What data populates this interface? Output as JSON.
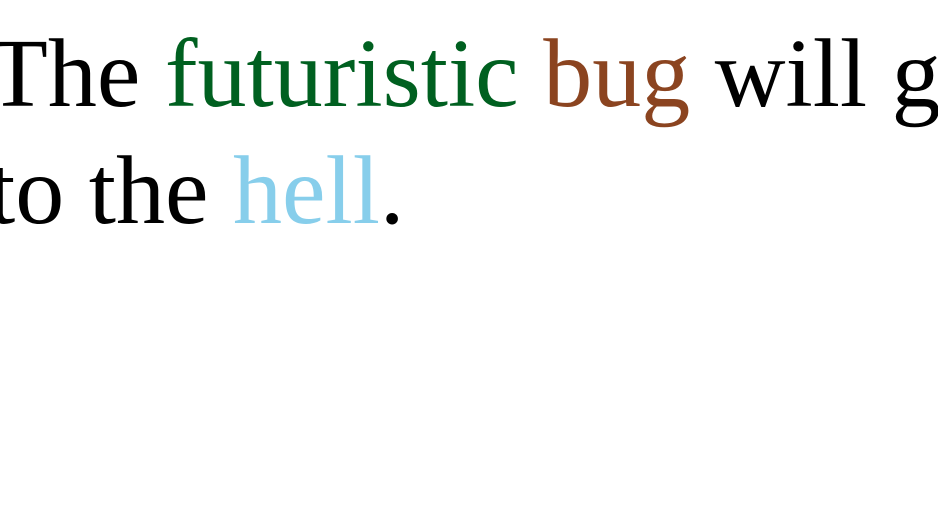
{
  "sentence": {
    "line1": {
      "w1": "The",
      "w2": "futuristic",
      "w3": "bug",
      "w4": "will",
      "w5": "go"
    },
    "line2": {
      "w1": "to",
      "w2": "the",
      "w3": "hell",
      "w4": "."
    }
  },
  "colors": {
    "default": "#000000",
    "futuristic": "#006020",
    "bug": "#8b4420",
    "hell": "#87ceeb"
  }
}
